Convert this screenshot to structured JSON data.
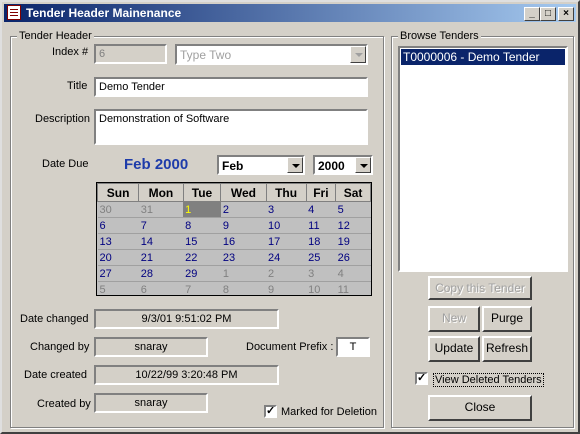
{
  "window": {
    "title": "Tender Header Mainenance"
  },
  "header_group": {
    "label": "Tender Header",
    "index_label": "Index #",
    "index_value": "6",
    "type_value": "Type Two",
    "title_label": "Title",
    "title_value": "Demo Tender",
    "description_label": "Description",
    "description_value": "Demonstration of Software",
    "date_due_label": "Date Due",
    "date_due_display": "Feb 2000",
    "month_value": "Feb",
    "year_value": "2000"
  },
  "calendar": {
    "days": [
      "Sun",
      "Mon",
      "Tue",
      "Wed",
      "Thu",
      "Fri",
      "Sat"
    ],
    "weeks": [
      [
        {
          "d": "30",
          "o": true
        },
        {
          "d": "31",
          "o": true
        },
        {
          "d": "1",
          "s": true
        },
        {
          "d": "2"
        },
        {
          "d": "3"
        },
        {
          "d": "4"
        },
        {
          "d": "5"
        }
      ],
      [
        {
          "d": "6"
        },
        {
          "d": "7"
        },
        {
          "d": "8"
        },
        {
          "d": "9"
        },
        {
          "d": "10"
        },
        {
          "d": "11"
        },
        {
          "d": "12"
        }
      ],
      [
        {
          "d": "13"
        },
        {
          "d": "14"
        },
        {
          "d": "15"
        },
        {
          "d": "16"
        },
        {
          "d": "17"
        },
        {
          "d": "18"
        },
        {
          "d": "19"
        }
      ],
      [
        {
          "d": "20"
        },
        {
          "d": "21"
        },
        {
          "d": "22"
        },
        {
          "d": "23"
        },
        {
          "d": "24"
        },
        {
          "d": "25"
        },
        {
          "d": "26"
        }
      ],
      [
        {
          "d": "27"
        },
        {
          "d": "28"
        },
        {
          "d": "29"
        },
        {
          "d": "1",
          "o": true
        },
        {
          "d": "2",
          "o": true
        },
        {
          "d": "3",
          "o": true
        },
        {
          "d": "4",
          "o": true
        }
      ],
      [
        {
          "d": "5",
          "o": true
        },
        {
          "d": "6",
          "o": true
        },
        {
          "d": "7",
          "o": true
        },
        {
          "d": "8",
          "o": true
        },
        {
          "d": "9",
          "o": true
        },
        {
          "d": "10",
          "o": true
        },
        {
          "d": "11",
          "o": true
        }
      ]
    ]
  },
  "audit": {
    "date_changed_label": "Date changed",
    "date_changed_value": "9/3/01 9:51:02 PM",
    "changed_by_label": "Changed by",
    "changed_by_value": "snaray",
    "date_created_label": "Date created",
    "date_created_value": "10/22/99 3:20:48 PM",
    "created_by_label": "Created by",
    "created_by_value": "snaray",
    "doc_prefix_label": "Document Prefix :",
    "doc_prefix_value": "T",
    "marked_deletion_label": "Marked for Deletion"
  },
  "browse": {
    "label": "Browse Tenders",
    "items": [
      "T0000006 - Demo Tender"
    ],
    "copy_label": "Copy this Tender",
    "new_label": "New",
    "purge_label": "Purge",
    "update_label": "Update",
    "refresh_label": "Refresh",
    "view_deleted_label": "View Deleted Tenders",
    "close_label": "Close"
  },
  "icons": [
    "app-icon",
    "minimize-icon",
    "maximize-icon",
    "close-icon",
    "dropdown-arrow-icon",
    "checkmark-icon"
  ]
}
